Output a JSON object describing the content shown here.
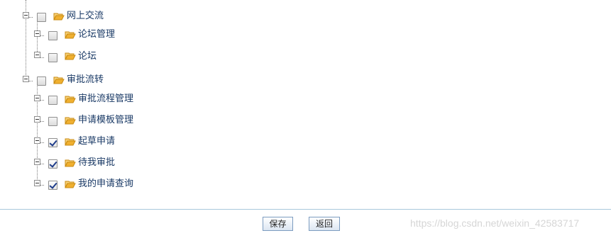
{
  "tree": {
    "groups": [
      {
        "label": "网上交流",
        "checked": false,
        "children": [
          {
            "label": "论坛管理",
            "checked": false
          },
          {
            "label": "论坛",
            "checked": false
          }
        ]
      },
      {
        "label": "审批流转",
        "checked": false,
        "children": [
          {
            "label": "审批流程管理",
            "checked": false
          },
          {
            "label": "申请模板管理",
            "checked": false
          },
          {
            "label": "起草申请",
            "checked": true
          },
          {
            "label": "待我审批",
            "checked": true
          },
          {
            "label": "我的申请查询",
            "checked": true
          }
        ]
      }
    ]
  },
  "footer": {
    "save_label": "保存",
    "back_label": "返回"
  },
  "watermark": "https://blog.csdn.net/weixin_42583717",
  "colors": {
    "text": "#1a3a66",
    "folder": "#f0a020",
    "divider": "#a8c8dc",
    "button_border": "#7c9cc0"
  },
  "icons": {
    "toggle": "collapse-minus-icon",
    "folder": "open-folder-icon"
  }
}
